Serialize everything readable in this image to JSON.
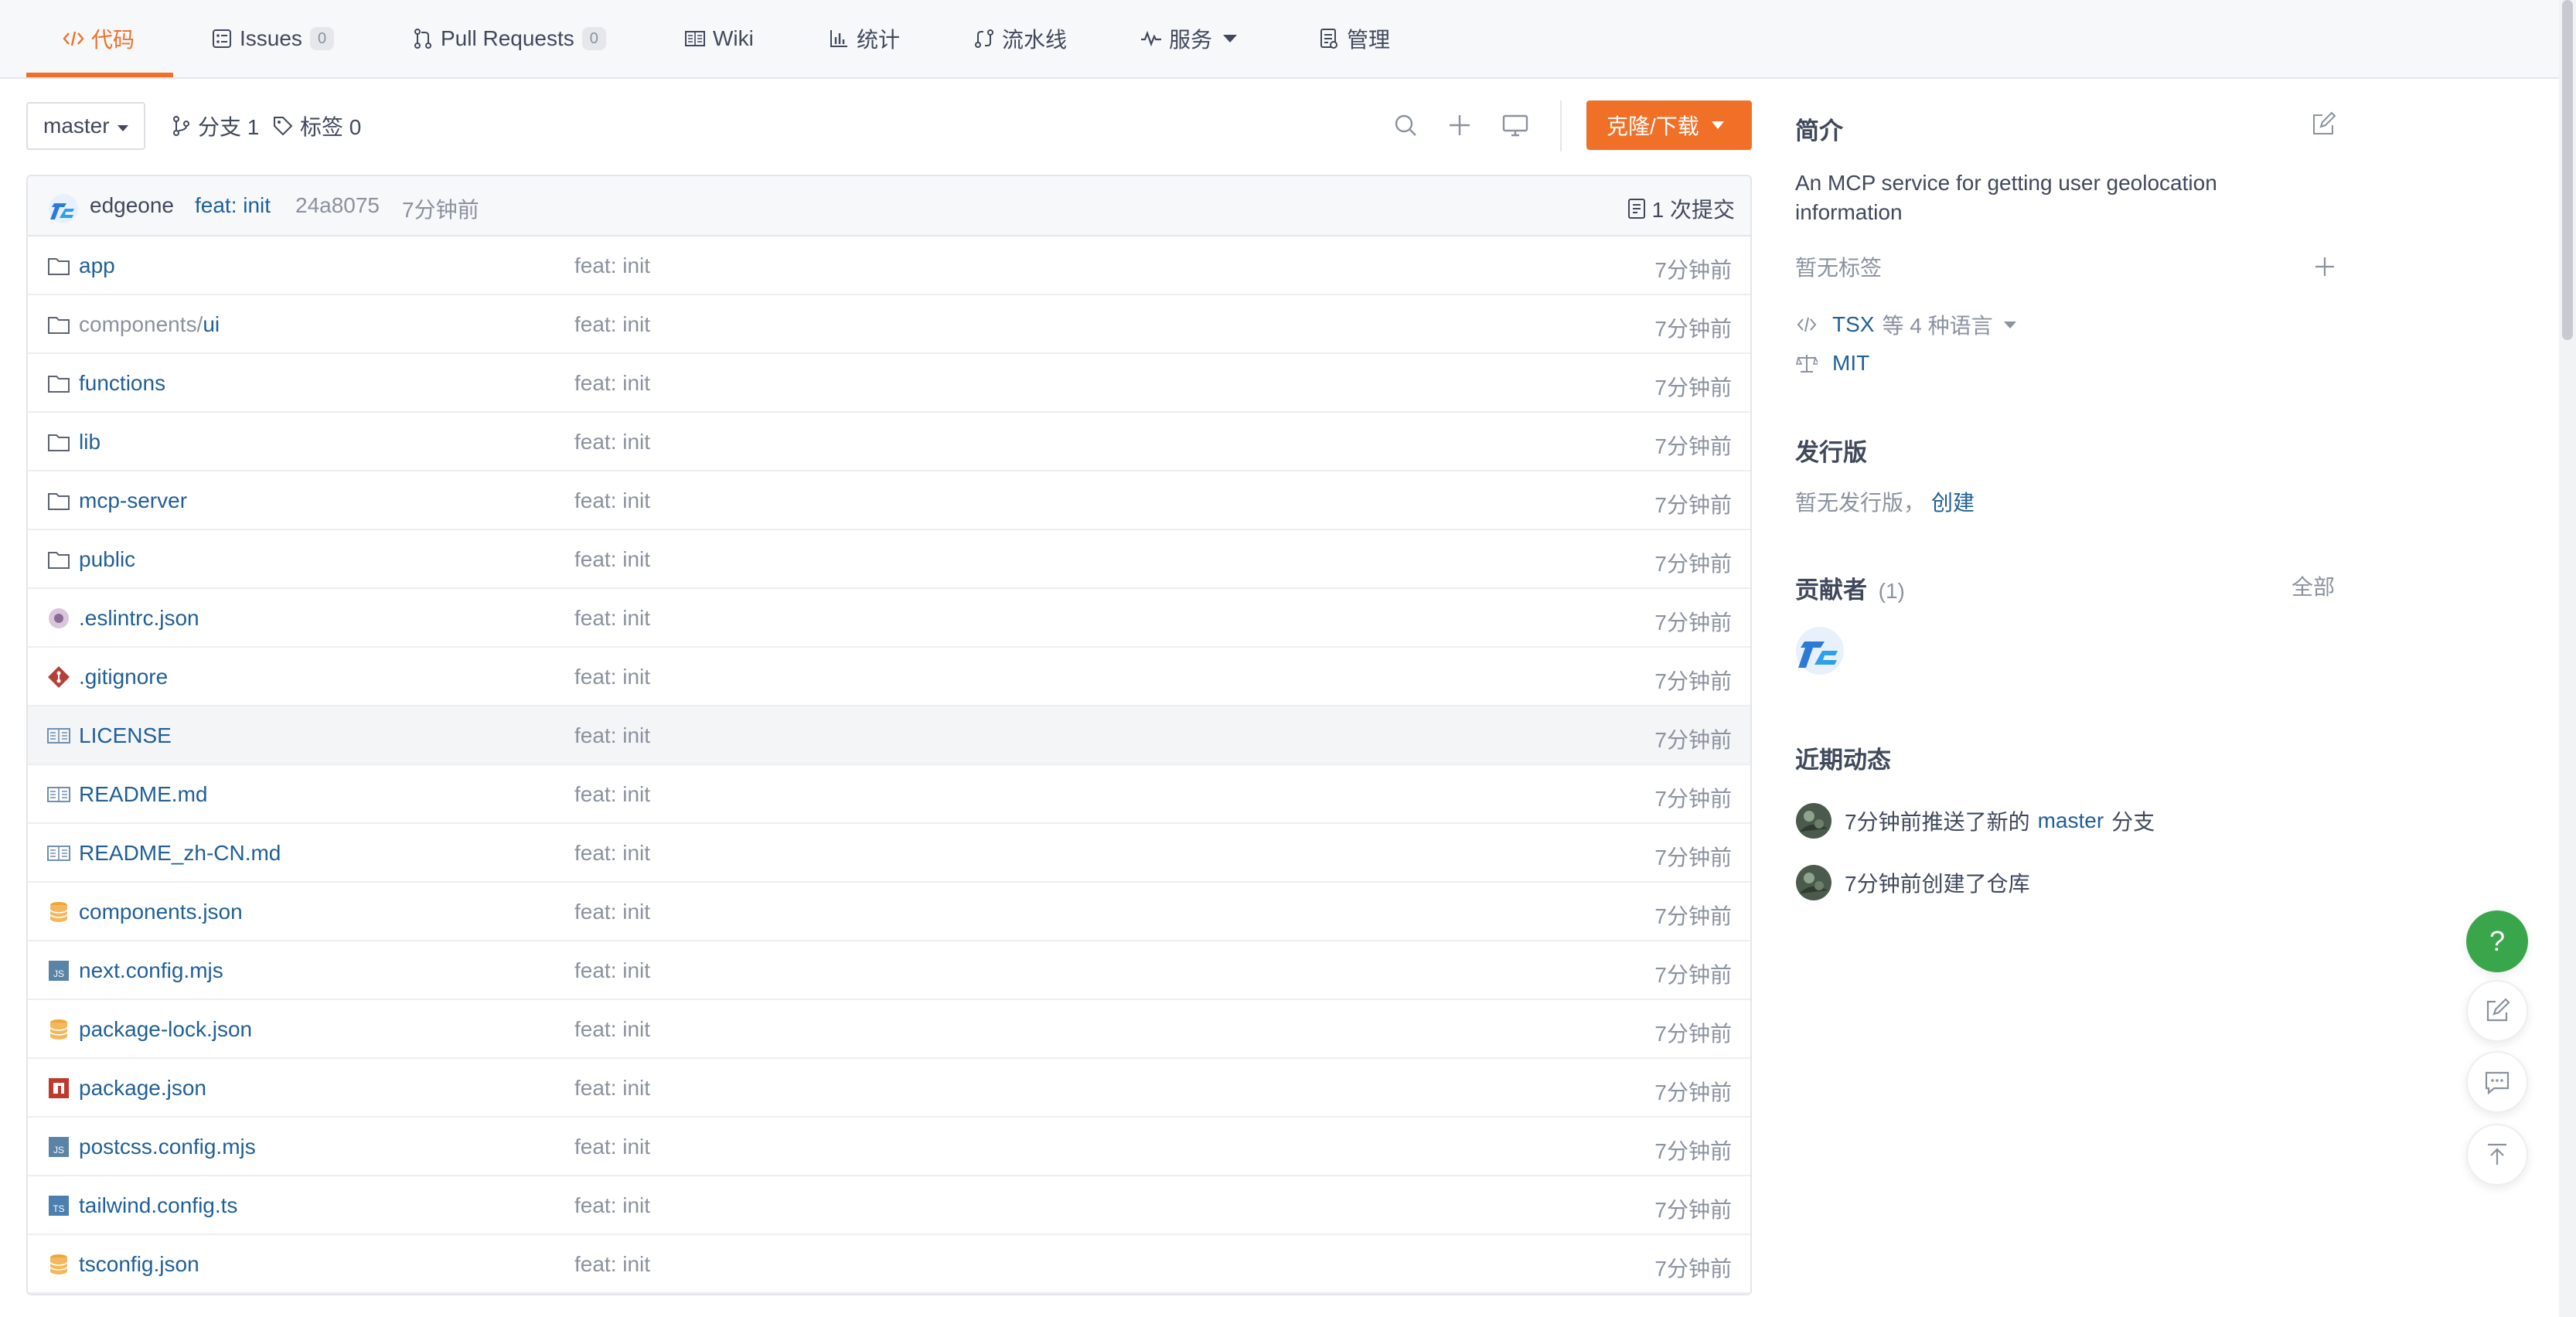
{
  "tabs": [
    {
      "label": "代码",
      "icon": "code-icon"
    },
    {
      "label": "Issues",
      "count": "0",
      "icon": "issues-icon"
    },
    {
      "label": "Pull Requests",
      "count": "0",
      "icon": "pull-request-icon"
    },
    {
      "label": "Wiki",
      "icon": "wiki-icon"
    },
    {
      "label": "统计",
      "icon": "stats-icon"
    },
    {
      "label": "流水线",
      "icon": "pipeline-icon"
    },
    {
      "label": "服务",
      "icon": "service-icon"
    },
    {
      "label": "管理",
      "icon": "manage-icon"
    }
  ],
  "toolbar": {
    "branch": "master",
    "branches": "分支 1",
    "tags": "标签 0",
    "clone_label": "克隆/下载"
  },
  "commit": {
    "author": "edgeone",
    "message": "feat: init",
    "sha": "24a8075",
    "time": "7分钟前",
    "count_label": "1 次提交"
  },
  "files": [
    {
      "name": "app",
      "name_prefix": "",
      "type": "folder",
      "commit": "feat: init",
      "time": "7分钟前"
    },
    {
      "name": "ui",
      "name_prefix": "components/",
      "type": "folder",
      "commit": "feat: init",
      "time": "7分钟前"
    },
    {
      "name": "functions",
      "name_prefix": "",
      "type": "folder",
      "commit": "feat: init",
      "time": "7分钟前"
    },
    {
      "name": "lib",
      "name_prefix": "",
      "type": "folder",
      "commit": "feat: init",
      "time": "7分钟前"
    },
    {
      "name": "mcp-server",
      "name_prefix": "",
      "type": "folder",
      "commit": "feat: init",
      "time": "7分钟前"
    },
    {
      "name": "public",
      "name_prefix": "",
      "type": "folder",
      "commit": "feat: init",
      "time": "7分钟前"
    },
    {
      "name": ".eslintrc.json",
      "name_prefix": "",
      "type": "eslint",
      "commit": "feat: init",
      "time": "7分钟前"
    },
    {
      "name": ".gitignore",
      "name_prefix": "",
      "type": "git",
      "commit": "feat: init",
      "time": "7分钟前"
    },
    {
      "name": "LICENSE",
      "name_prefix": "",
      "type": "doc",
      "commit": "feat: init",
      "time": "7分钟前"
    },
    {
      "name": "README.md",
      "name_prefix": "",
      "type": "doc",
      "commit": "feat: init",
      "time": "7分钟前"
    },
    {
      "name": "README_zh-CN.md",
      "name_prefix": "",
      "type": "doc",
      "commit": "feat: init",
      "time": "7分钟前"
    },
    {
      "name": "components.json",
      "name_prefix": "",
      "type": "json",
      "commit": "feat: init",
      "time": "7分钟前"
    },
    {
      "name": "next.config.mjs",
      "name_prefix": "",
      "type": "js",
      "commit": "feat: init",
      "time": "7分钟前"
    },
    {
      "name": "package-lock.json",
      "name_prefix": "",
      "type": "json",
      "commit": "feat: init",
      "time": "7分钟前"
    },
    {
      "name": "package.json",
      "name_prefix": "",
      "type": "npm",
      "commit": "feat: init",
      "time": "7分钟前"
    },
    {
      "name": "postcss.config.mjs",
      "name_prefix": "",
      "type": "js",
      "commit": "feat: init",
      "time": "7分钟前"
    },
    {
      "name": "tailwind.config.ts",
      "name_prefix": "",
      "type": "ts",
      "commit": "feat: init",
      "time": "7分钟前"
    },
    {
      "name": "tsconfig.json",
      "name_prefix": "",
      "type": "json",
      "commit": "feat: init",
      "time": "7分钟前"
    }
  ],
  "sidebar": {
    "intro_title": "简介",
    "description": "An MCP service for getting user geolocation information",
    "no_tags": "暂无标签",
    "language": "TSX",
    "language_more": "等 4 种语言",
    "license": "MIT",
    "release_title": "发行版",
    "release_empty": "暂无发行版，",
    "release_create": "创建",
    "contributors_title": "贡献者",
    "contributors_count": "(1)",
    "contributors_all": "全部",
    "activity_title": "近期动态",
    "activities": [
      {
        "prefix": "7分钟前推送了新的",
        "branch": "master",
        "suffix": "分支"
      },
      {
        "prefix": "7分钟前创建了仓库",
        "branch": "",
        "suffix": ""
      }
    ]
  },
  "fab": {
    "help": "?"
  },
  "colors": {
    "accent": "#f07028",
    "link": "#1f5f97",
    "help": "#3aa64b",
    "muted": "#8a919f"
  }
}
